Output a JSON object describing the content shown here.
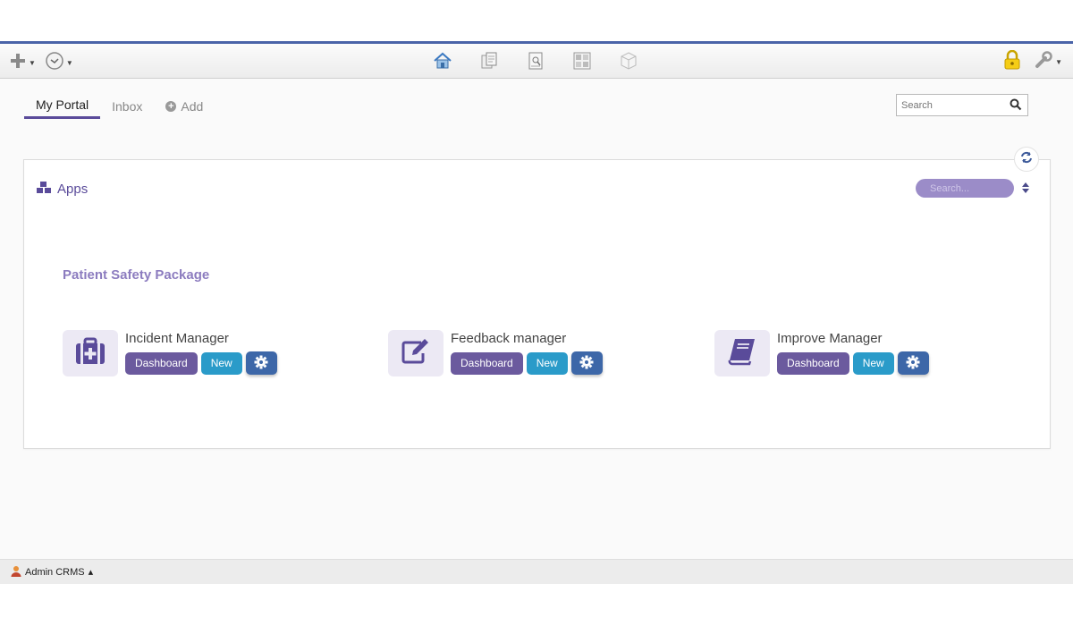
{
  "toolbar": {
    "left": [
      {
        "icon": "add-icon"
      },
      {
        "icon": "history-clock-icon"
      }
    ],
    "center": [
      {
        "icon": "home-icon"
      },
      {
        "icon": "documents-icon"
      },
      {
        "icon": "report-icon"
      },
      {
        "icon": "dashboard-grid-icon"
      },
      {
        "icon": "package-box-icon"
      }
    ],
    "right": [
      {
        "icon": "lock-icon"
      },
      {
        "icon": "tools-wrench-icon"
      }
    ],
    "accent_color": "#4a63a8"
  },
  "tabs": {
    "my_portal": "My Portal",
    "inbox": "Inbox",
    "add": "Add"
  },
  "search": {
    "placeholder": "Search"
  },
  "panel": {
    "title": "Apps",
    "search_placeholder": "Search...",
    "package_title": "Patient Safety Package",
    "apps": [
      {
        "name": "Incident Manager",
        "icon": "first-aid-kit-icon",
        "dashboard": "Dashboard",
        "new": "New"
      },
      {
        "name": "Feedback manager",
        "icon": "edit-form-icon",
        "dashboard": "Dashboard",
        "new": "New"
      },
      {
        "name": "Improve Manager",
        "icon": "book-icon",
        "dashboard": "Dashboard",
        "new": "New"
      }
    ],
    "colors": {
      "primary": "#5a4b9a",
      "dashboard_button": "#6b5a9e",
      "new_button": "#2a9bc9",
      "settings_button": "#3d67a8"
    }
  },
  "footer": {
    "user_label": "Admin CRMS",
    "caret": "▴"
  }
}
